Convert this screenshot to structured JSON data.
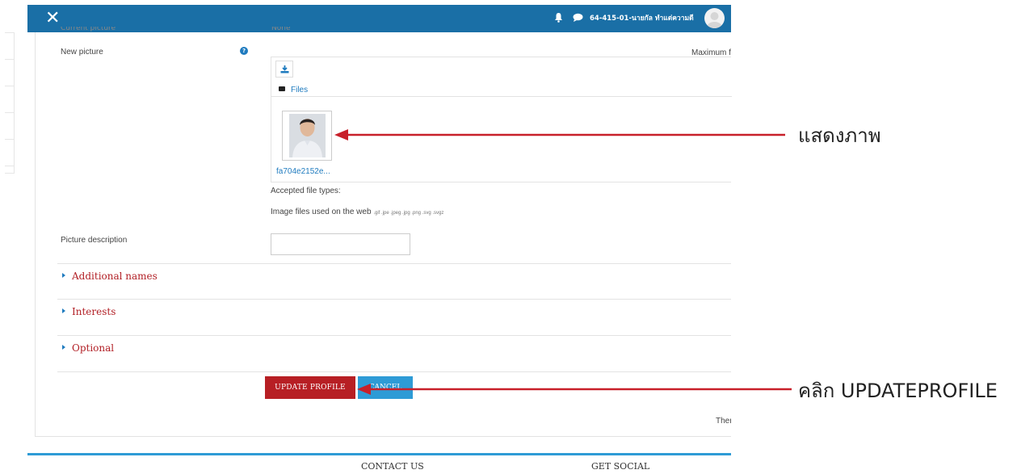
{
  "navbar": {
    "close_glyph": "✕",
    "user_name": "64-415-01-นายกัล ทำแต่ความดี"
  },
  "form": {
    "current_picture_label": "Current picture",
    "current_picture_value": "None",
    "new_picture_label": "New picture",
    "max_size_text": "Maximum f",
    "files_label": "Files",
    "file_name": "fa704e2152e...",
    "accepted_types_label": "Accepted file types:",
    "image_types_label": "Image files used on the web",
    "image_types_exts": ".gif .jpe .jpeg .jpg .png .svg .svgz",
    "picture_description_label": "Picture description",
    "picture_description_value": ""
  },
  "sections": [
    {
      "label": "Additional names"
    },
    {
      "label": "Interests"
    },
    {
      "label": "Optional"
    }
  ],
  "buttons": {
    "update": "UPDATE PROFILE",
    "cancel": "CANCEL"
  },
  "required_note": "Ther",
  "footer": {
    "contact": "CONTACT US",
    "social": "GET SOCIAL"
  },
  "annotations": {
    "show_picture": "แสดงภาพ",
    "click_update": "คลิก UPDATEPROFILE"
  },
  "colors": {
    "navbar": "#1a6fa6",
    "update_button": "#b71f24",
    "cancel_button": "#2e9bd6",
    "arrow": "#c8202a"
  }
}
